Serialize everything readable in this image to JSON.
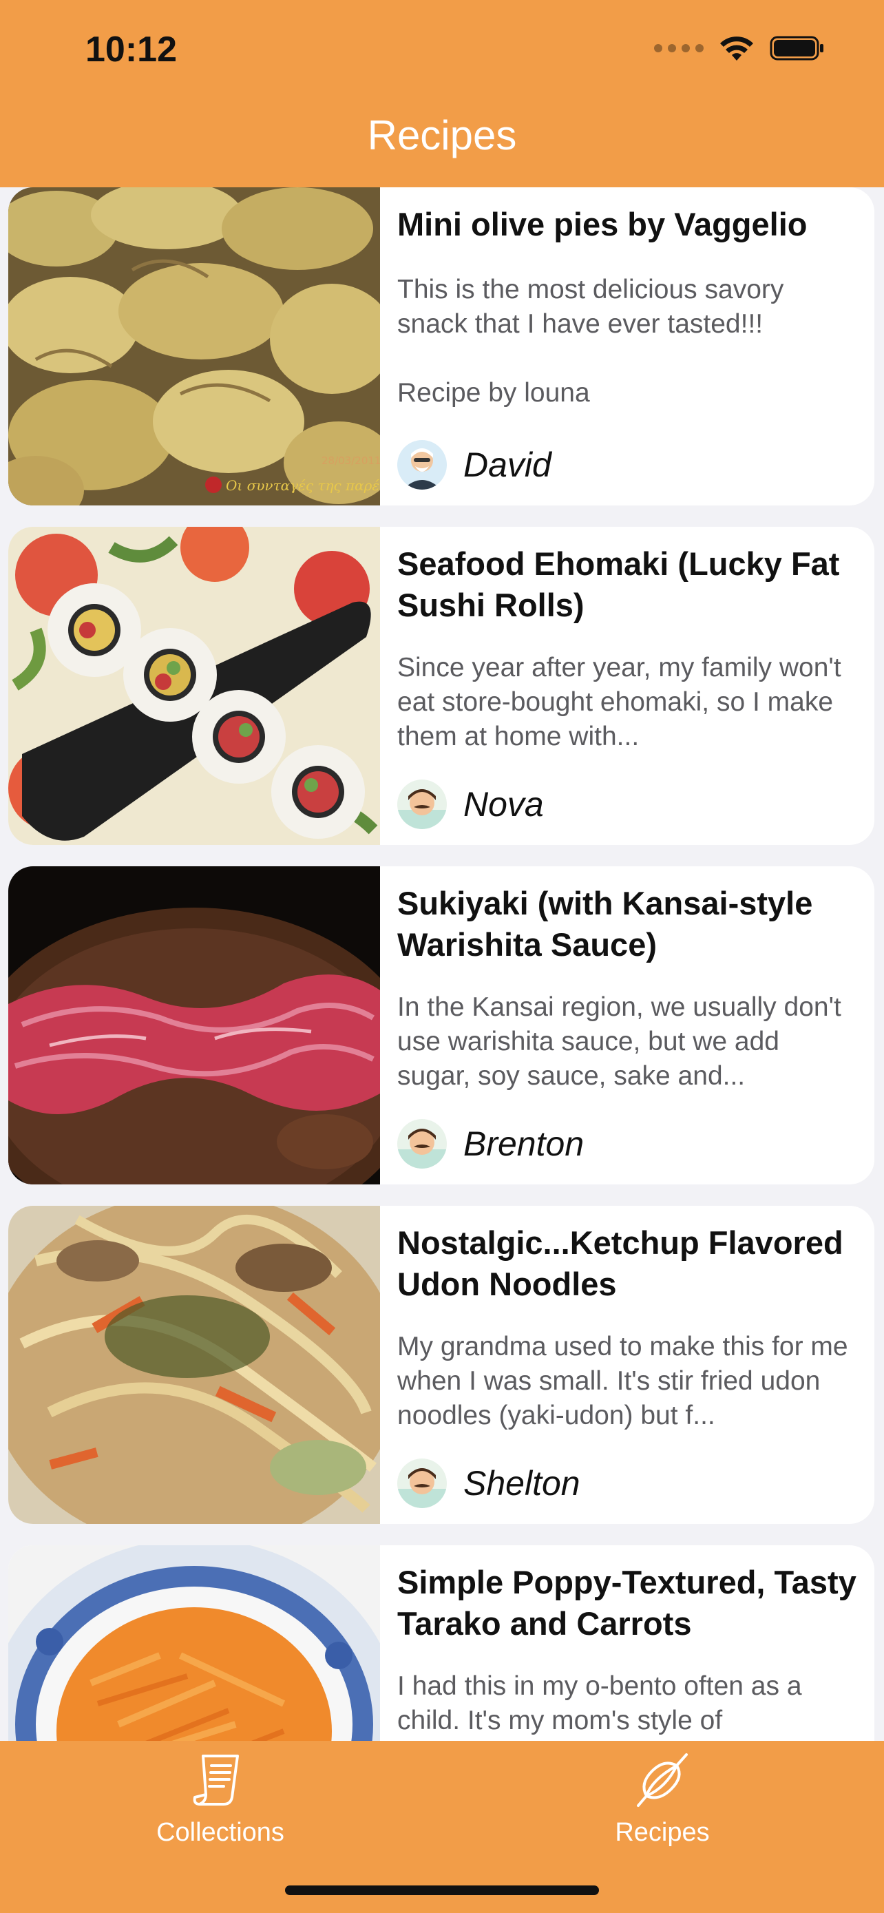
{
  "status_bar": {
    "time": "10:12"
  },
  "nav": {
    "title": "Recipes"
  },
  "recipes": [
    {
      "title": "Mini olive pies by Vaggelio",
      "description": "This is the most delicious savory snack that I have ever tasted!!!\n\nRecipe by louna",
      "author": "David",
      "image_watermark": "Οι συνταγές της παρέας",
      "image_date": "28/03/2011"
    },
    {
      "title": "Seafood Ehomaki (Lucky Fat Sushi Rolls)",
      "description": "Since year after year, my family won't eat store-bought ehomaki, so I make them at home with...",
      "author": "Nova"
    },
    {
      "title": "Sukiyaki (with Kansai-style Warishita Sauce)",
      "description": "In the Kansai region, we usually don't use warishita sauce, but we add sugar, soy sauce, sake and...",
      "author": "Brenton"
    },
    {
      "title": "Nostalgic...Ketchup Flavored Udon Noodles",
      "description": "My grandma used to make this for me when I was small. It's stir fried udon noodles (yaki-udon) but f...",
      "author": "Shelton"
    },
    {
      "title": "Simple Poppy-Textured, Tasty Tarako and Carrots",
      "description": "I had this in my o-bento often as a child. It's my mom's style of",
      "author": ""
    }
  ],
  "tabbar": {
    "items": [
      {
        "label": "Collections",
        "icon": "collections-icon"
      },
      {
        "label": "Recipes",
        "icon": "whisk-icon"
      }
    ]
  },
  "colors": {
    "accent": "#f29d48",
    "background": "#f2f2f6",
    "card": "#ffffff",
    "title_text": "#111111",
    "body_text": "#5b5b5f"
  }
}
